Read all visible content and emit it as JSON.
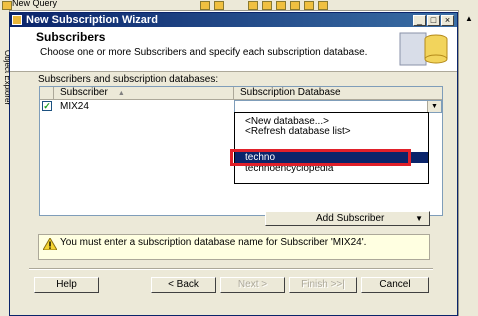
{
  "host": {
    "toolbar_text": "New Query",
    "side_tab": "Object Explorer"
  },
  "window": {
    "title": "New Subscription Wizard"
  },
  "header": {
    "title": "Subscribers",
    "subtitle": "Choose one or more Subscribers and specify each subscription database."
  },
  "section_label": "Subscribers and subscription databases:",
  "grid": {
    "col_subscriber": "Subscriber",
    "col_database": "Subscription Database",
    "rows": [
      {
        "checked": true,
        "name": "MIX24",
        "database": ""
      }
    ]
  },
  "dropdown": {
    "options": [
      "<New database...>",
      "<Refresh database list>",
      "",
      "techno",
      "technoencyclopedia"
    ],
    "selected": "techno"
  },
  "add_subscriber_label": "Add Subscriber",
  "warning_text": "You must enter a subscription database name for Subscriber 'MIX24'.",
  "buttons": {
    "help": "Help",
    "back": "< Back",
    "next": "Next >",
    "finish": "Finish >>|",
    "cancel": "Cancel"
  },
  "colors": {
    "titlebar": "#0a246a",
    "highlight_box": "#e0202a",
    "selection": "#0a246a"
  }
}
